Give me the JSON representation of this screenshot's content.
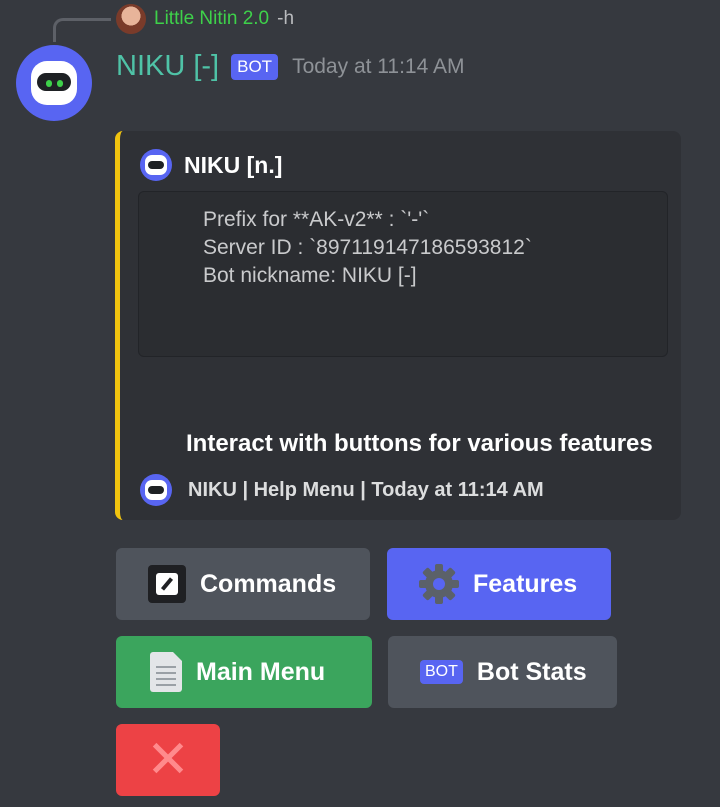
{
  "reply": {
    "username": "Little Nitin 2.0",
    "text": "-h"
  },
  "message": {
    "author": "NIKU [-]",
    "badge": "BOT",
    "timestamp": "Today at 11:14 AM"
  },
  "embed": {
    "accent_color": "#f1c40f",
    "author_name": "NIKU [n.]",
    "lines": [
      "Prefix for **AK-v2** : `'-'`",
      "Server ID : `897119147186593812`",
      "Bot nickname: NIKU [-]"
    ],
    "description": "Interact with buttons for various features",
    "footer": "NIKU | Help Menu | Today at 11:14 AM"
  },
  "buttons": {
    "commands": "Commands",
    "features": "Features",
    "main_menu": "Main Menu",
    "bot_stats": "Bot Stats",
    "bot_stats_badge": "BOT"
  },
  "icons": {
    "commands": "edit-square-icon",
    "features": "gear-icon",
    "main_menu": "document-icon",
    "close": "close-icon"
  }
}
